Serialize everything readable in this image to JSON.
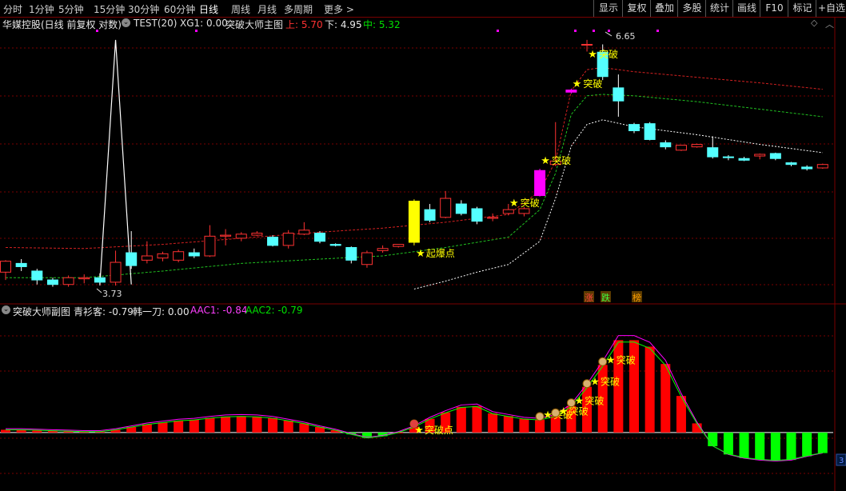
{
  "period_tabs": [
    {
      "id": "fenshi",
      "label": "分时",
      "active": false
    },
    {
      "id": "1m",
      "label": "1分钟",
      "active": false
    },
    {
      "id": "5m",
      "label": "5分钟",
      "active": false
    },
    {
      "id": "15m",
      "label": "15分钟",
      "active": false
    },
    {
      "id": "30m",
      "label": "30分钟",
      "active": false
    },
    {
      "id": "60m",
      "label": "60分钟",
      "active": false
    },
    {
      "id": "day",
      "label": "日线",
      "active": true
    },
    {
      "id": "week",
      "label": "周线",
      "active": false
    },
    {
      "id": "month",
      "label": "月线",
      "active": false
    },
    {
      "id": "multi",
      "label": "多周期",
      "active": false
    },
    {
      "id": "more",
      "label": "更多 >",
      "active": false
    }
  ],
  "toolbar_right": [
    "显示",
    "复权",
    "叠加",
    "多股",
    "统计",
    "画线",
    "F10",
    "标记",
    "+自选"
  ],
  "main_header": {
    "stock": "华媒控股(日线 前复权 对数)",
    "indicator_icon": "settings-circle-icon",
    "indicator": "TEST(20)",
    "xg1": "XG1: 0.00",
    "main_name": "突破大师主图",
    "upper": "上: 5.70",
    "lower": "下: 4.95",
    "middle": "中: 5.32"
  },
  "sub_header": {
    "name": "突破大师副图",
    "qsk": "青衫客: -0.79",
    "hyd": "韩一刀: 0.00",
    "aac1": "AAC1: -0.84",
    "aac2": "AAC2: -0.79"
  },
  "main_annotations": {
    "high": "6.65",
    "low": "3.73",
    "qbd": "起爆点",
    "tupo": "突破",
    "tupo_dian": "突破点",
    "zhang": "涨",
    "die": "跌",
    "bang": "榜",
    "scroll_num": "3"
  },
  "colors": {
    "up": "#ff3232",
    "down": "#54ffff",
    "yellow": "#ffff00",
    "magenta": "#ff00ff",
    "green_bar": "#00ff00",
    "red_bar": "#ff0000",
    "grid": "#7a0000",
    "aac1": "#ff00ff",
    "aac2": "#00ff00"
  },
  "chart_data": {
    "type": "candlestick",
    "ylim": [
      3.6,
      6.8
    ],
    "candles": [
      {
        "o": 3.85,
        "c": 3.95,
        "h": 3.96,
        "l": 3.78,
        "mark": ""
      },
      {
        "o": 3.93,
        "c": 3.9,
        "h": 3.97,
        "l": 3.86,
        "mark": ""
      },
      {
        "o": 3.86,
        "c": 3.78,
        "h": 3.88,
        "l": 3.74,
        "mark": ""
      },
      {
        "o": 3.78,
        "c": 3.74,
        "h": 3.8,
        "l": 3.72,
        "mark": ""
      },
      {
        "o": 3.74,
        "c": 3.8,
        "h": 3.82,
        "l": 3.72,
        "mark": ""
      },
      {
        "o": 3.79,
        "c": 3.8,
        "h": 3.83,
        "l": 3.75,
        "mark": ""
      },
      {
        "o": 3.8,
        "c": 3.76,
        "h": 3.84,
        "l": 3.73,
        "mark": ""
      },
      {
        "o": 3.76,
        "c": 3.94,
        "h": 4.05,
        "l": 3.73,
        "mark": ""
      },
      {
        "o": 4.03,
        "c": 3.91,
        "h": 4.24,
        "l": 3.88,
        "mark": ""
      },
      {
        "o": 3.96,
        "c": 4.0,
        "h": 4.14,
        "l": 3.93,
        "mark": ""
      },
      {
        "o": 3.98,
        "c": 4.02,
        "h": 4.04,
        "l": 3.95,
        "mark": ""
      },
      {
        "o": 3.96,
        "c": 4.04,
        "h": 4.06,
        "l": 3.94,
        "mark": ""
      },
      {
        "o": 4.03,
        "c": 4.0,
        "h": 4.07,
        "l": 3.98,
        "mark": ""
      },
      {
        "o": 4.0,
        "c": 4.19,
        "h": 4.3,
        "l": 3.99,
        "mark": ""
      },
      {
        "o": 4.19,
        "c": 4.2,
        "h": 4.26,
        "l": 4.1,
        "mark": ""
      },
      {
        "o": 4.17,
        "c": 4.21,
        "h": 4.23,
        "l": 4.14,
        "mark": ""
      },
      {
        "o": 4.2,
        "c": 4.22,
        "h": 4.24,
        "l": 4.19,
        "mark": ""
      },
      {
        "o": 4.18,
        "c": 4.1,
        "h": 4.2,
        "l": 4.09,
        "mark": ""
      },
      {
        "o": 4.1,
        "c": 4.22,
        "h": 4.25,
        "l": 4.07,
        "mark": ""
      },
      {
        "o": 4.21,
        "c": 4.25,
        "h": 4.33,
        "l": 4.2,
        "mark": ""
      },
      {
        "o": 4.22,
        "c": 4.14,
        "h": 4.24,
        "l": 4.12,
        "mark": ""
      },
      {
        "o": 4.11,
        "c": 4.1,
        "h": 4.12,
        "l": 4.09,
        "mark": ""
      },
      {
        "o": 4.08,
        "c": 3.96,
        "h": 4.09,
        "l": 3.93,
        "mark": ""
      },
      {
        "o": 3.92,
        "c": 4.03,
        "h": 4.05,
        "l": 3.89,
        "mark": ""
      },
      {
        "o": 4.05,
        "c": 4.07,
        "h": 4.1,
        "l": 4.03,
        "mark": ""
      },
      {
        "o": 4.09,
        "c": 4.11,
        "h": 4.11,
        "l": 4.08,
        "mark": ""
      },
      {
        "o": 4.13,
        "c": 4.55,
        "h": 4.57,
        "l": 4.1,
        "mark": "qbd"
      },
      {
        "o": 4.46,
        "c": 4.35,
        "h": 4.52,
        "l": 4.33,
        "mark": ""
      },
      {
        "o": 4.38,
        "c": 4.58,
        "h": 4.66,
        "l": 4.37,
        "mark": ""
      },
      {
        "o": 4.52,
        "c": 4.42,
        "h": 4.56,
        "l": 4.4,
        "mark": ""
      },
      {
        "o": 4.47,
        "c": 4.34,
        "h": 4.49,
        "l": 4.31,
        "mark": ""
      },
      {
        "o": 4.37,
        "c": 4.38,
        "h": 4.42,
        "l": 4.34,
        "mark": ""
      },
      {
        "o": 4.42,
        "c": 4.46,
        "h": 4.52,
        "l": 4.4,
        "mark": ""
      },
      {
        "o": 4.42,
        "c": 4.47,
        "h": 4.49,
        "l": 4.39,
        "mark": ""
      },
      {
        "o": 4.61,
        "c": 4.89,
        "h": 4.91,
        "l": 4.6,
        "mark": "magenta"
      },
      {
        "o": 4.96,
        "c": 5.0,
        "h": 5.48,
        "l": 4.94,
        "mark": ""
      },
      {
        "o": 5.88,
        "c": 5.91,
        "h": 5.93,
        "l": 5.86,
        "mark": "magenta"
      },
      {
        "o": 6.58,
        "c": 6.58,
        "h": 6.65,
        "l": 6.47,
        "mark": ""
      },
      {
        "o": 6.46,
        "c": 6.1,
        "h": 6.58,
        "l": 6.05,
        "mark": ""
      },
      {
        "o": 5.94,
        "c": 5.76,
        "h": 6.13,
        "l": 5.55,
        "mark": ""
      },
      {
        "o": 5.45,
        "c": 5.37,
        "h": 5.47,
        "l": 5.34,
        "mark": ""
      },
      {
        "o": 5.46,
        "c": 5.26,
        "h": 5.48,
        "l": 5.25,
        "mark": ""
      },
      {
        "o": 5.22,
        "c": 5.17,
        "h": 5.25,
        "l": 5.14,
        "mark": ""
      },
      {
        "o": 5.13,
        "c": 5.19,
        "h": 5.19,
        "l": 5.12,
        "mark": ""
      },
      {
        "o": 5.17,
        "c": 5.2,
        "h": 5.21,
        "l": 5.16,
        "mark": ""
      },
      {
        "o": 5.16,
        "c": 5.05,
        "h": 5.3,
        "l": 5.03,
        "mark": ""
      },
      {
        "o": 5.05,
        "c": 5.04,
        "h": 5.07,
        "l": 5.01,
        "mark": ""
      },
      {
        "o": 5.03,
        "c": 5.01,
        "h": 5.05,
        "l": 5.0,
        "mark": ""
      },
      {
        "o": 5.06,
        "c": 5.08,
        "h": 5.09,
        "l": 5.02,
        "mark": ""
      },
      {
        "o": 5.09,
        "c": 5.03,
        "h": 5.1,
        "l": 5.01,
        "mark": ""
      },
      {
        "o": 4.98,
        "c": 4.96,
        "h": 4.99,
        "l": 4.94,
        "mark": ""
      },
      {
        "o": 4.93,
        "c": 4.91,
        "h": 4.95,
        "l": 4.89,
        "mark": ""
      },
      {
        "o": 4.92,
        "c": 4.96,
        "h": 4.97,
        "l": 4.91,
        "mark": ""
      }
    ],
    "upper_band": [
      {
        "i": 0,
        "v": 4.08
      },
      {
        "i": 5,
        "v": 4.07
      },
      {
        "i": 10,
        "v": 4.11
      },
      {
        "i": 15,
        "v": 4.17
      },
      {
        "i": 20,
        "v": 4.23
      },
      {
        "i": 24,
        "v": 4.27
      },
      {
        "i": 28,
        "v": 4.33
      },
      {
        "i": 32,
        "v": 4.41
      },
      {
        "i": 34,
        "v": 4.66
      },
      {
        "i": 35,
        "v": 5.0
      },
      {
        "i": 36,
        "v": 5.9
      },
      {
        "i": 37,
        "v": 6.2
      },
      {
        "i": 38,
        "v": 6.23
      },
      {
        "i": 40,
        "v": 6.17
      },
      {
        "i": 44,
        "v": 6.09
      },
      {
        "i": 48,
        "v": 6.01
      },
      {
        "i": 52,
        "v": 5.92
      }
    ],
    "middle_band": [
      {
        "i": 0,
        "v": 3.8
      },
      {
        "i": 5,
        "v": 3.8
      },
      {
        "i": 10,
        "v": 3.86
      },
      {
        "i": 15,
        "v": 3.93
      },
      {
        "i": 20,
        "v": 3.97
      },
      {
        "i": 24,
        "v": 4.0
      },
      {
        "i": 28,
        "v": 4.08
      },
      {
        "i": 32,
        "v": 4.18
      },
      {
        "i": 34,
        "v": 4.46
      },
      {
        "i": 35,
        "v": 4.86
      },
      {
        "i": 36,
        "v": 5.58
      },
      {
        "i": 37,
        "v": 5.83
      },
      {
        "i": 38,
        "v": 5.85
      },
      {
        "i": 40,
        "v": 5.83
      },
      {
        "i": 44,
        "v": 5.75
      },
      {
        "i": 48,
        "v": 5.65
      },
      {
        "i": 52,
        "v": 5.55
      }
    ],
    "lower_band": [
      {
        "i": 26,
        "v": 3.7
      },
      {
        "i": 28,
        "v": 3.77
      },
      {
        "i": 30,
        "v": 3.85
      },
      {
        "i": 32,
        "v": 3.92
      },
      {
        "i": 34,
        "v": 4.14
      },
      {
        "i": 35,
        "v": 4.58
      },
      {
        "i": 36,
        "v": 5.18
      },
      {
        "i": 37,
        "v": 5.45
      },
      {
        "i": 38,
        "v": 5.51
      },
      {
        "i": 40,
        "v": 5.42
      },
      {
        "i": 44,
        "v": 5.32
      },
      {
        "i": 48,
        "v": 5.2
      },
      {
        "i": 52,
        "v": 5.1
      }
    ],
    "spike_line": [
      {
        "i": 6,
        "v": 3.74
      },
      {
        "i": 7,
        "v": 6.65
      },
      {
        "i": 8,
        "v": 3.74
      }
    ],
    "sub": {
      "ylim": [
        -1.0,
        2.5
      ],
      "hist": [
        0.06,
        0.06,
        0.05,
        0.04,
        0.03,
        0.02,
        0.02,
        0.06,
        0.12,
        0.18,
        0.22,
        0.26,
        0.28,
        0.32,
        0.35,
        0.36,
        0.35,
        0.32,
        0.26,
        0.2,
        0.12,
        0.05,
        -0.04,
        -0.12,
        -0.08,
        0.0,
        0.12,
        0.3,
        0.44,
        0.56,
        0.58,
        0.42,
        0.36,
        0.3,
        0.28,
        0.36,
        0.58,
        1.0,
        1.48,
        2.02,
        2.02,
        1.88,
        1.5,
        0.8,
        0.2,
        -0.3,
        -0.48,
        -0.56,
        -0.6,
        -0.62,
        -0.6,
        -0.52,
        -0.45
      ],
      "tags": [
        {
          "i": 26,
          "type": "tupo_dian"
        },
        {
          "i": 34,
          "type": "tupo"
        },
        {
          "i": 35,
          "type": "tupo"
        },
        {
          "i": 36,
          "type": "tupo"
        },
        {
          "i": 37,
          "type": "tupo"
        },
        {
          "i": 38,
          "type": "tupo"
        }
      ]
    }
  }
}
